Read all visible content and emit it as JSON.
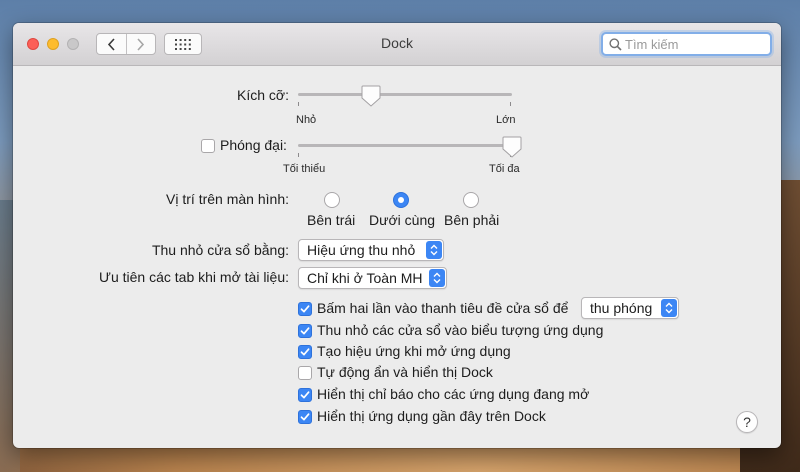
{
  "window": {
    "title": "Dock",
    "search_placeholder": "Tìm kiếm"
  },
  "size": {
    "label": "Kích cỡ:",
    "min_label": "Nhỏ",
    "max_label": "Lớn",
    "value_fraction": 0.34
  },
  "magnification": {
    "label": "Phóng đại:",
    "checked": false,
    "min_label": "Tối thiểu",
    "max_label": "Tối đa",
    "value_fraction": 1.0
  },
  "position": {
    "label": "Vị trí trên màn hình:",
    "options": [
      {
        "label": "Bên trái",
        "selected": false
      },
      {
        "label": "Dưới cùng",
        "selected": true
      },
      {
        "label": "Bên phải",
        "selected": false
      }
    ]
  },
  "minimize": {
    "label": "Thu nhỏ cửa sổ bằng:",
    "value": "Hiệu ứng thu nhỏ"
  },
  "prefer_tabs": {
    "label": "Ưu tiên các tab khi mở tài liệu:",
    "value": "Chỉ khi ở Toàn MH"
  },
  "checkboxes": [
    {
      "label": "Bấm hai lần vào thanh tiêu đề cửa sổ để",
      "checked": true,
      "popup_value": "thu phóng"
    },
    {
      "label": "Thu nhỏ các cửa sổ vào biểu tượng ứng dụng",
      "checked": true
    },
    {
      "label": "Tạo hiệu ứng khi mở ứng dụng",
      "checked": true
    },
    {
      "label": "Tự động ẩn và hiển thị Dock",
      "checked": false
    },
    {
      "label": "Hiển thị chỉ báo cho các ứng dụng đang mở",
      "checked": true
    },
    {
      "label": "Hiển thị ứng dụng gần đây trên Dock",
      "checked": true
    }
  ],
  "help": {
    "label": "?"
  },
  "colors": {
    "accent": "#3c86f4",
    "window_bg": "#ececec",
    "close": "#fc5f57",
    "minimize": "#fdbc2e",
    "zoom_disabled": "#c9c8c9"
  },
  "icons": {
    "back": "chevron-left-icon",
    "forward": "chevron-right-icon",
    "show_all": "grid-icon",
    "search": "magnifier-icon",
    "checkmark": "checkmark-icon",
    "popup": "up-down-arrows-icon"
  }
}
